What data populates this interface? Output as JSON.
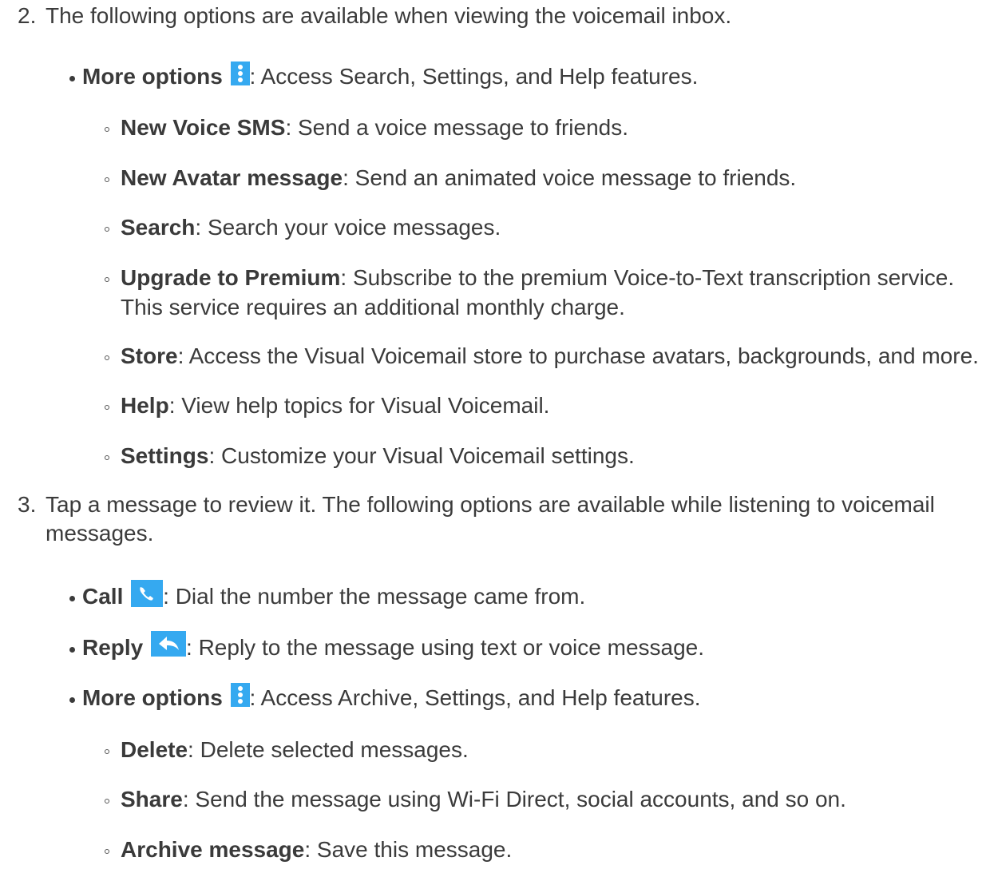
{
  "step2": {
    "number": "2.",
    "text": "The following options are available when viewing the voicemail inbox.",
    "more_options": {
      "label": "More options",
      "icon": "more-vert-icon",
      "desc": ": Access Search, Settings, and Help features."
    },
    "sub_items": [
      {
        "label": "New Voice SMS",
        "desc": ": Send a voice message to friends."
      },
      {
        "label": "New Avatar message",
        "desc": ": Send an animated voice message to friends."
      },
      {
        "label": "Search",
        "desc": ": Search your voice messages."
      },
      {
        "label": "Upgrade to Premium",
        "desc": ": Subscribe to the premium Voice-to-Text transcription service.",
        "desc2": "This service requires an additional monthly charge."
      },
      {
        "label": "Store",
        "desc": ": Access the Visual Voicemail store to purchase avatars, backgrounds, and more."
      },
      {
        "label": "Help",
        "desc": ": View help topics for Visual Voicemail."
      },
      {
        "label": "Settings",
        "desc": ": Customize your Visual Voicemail settings."
      }
    ]
  },
  "step3": {
    "number": "3.",
    "text_line1": "Tap a message to review it. The following options are available while listening to voicemail",
    "text_line2": "messages.",
    "items": [
      {
        "label": "Call",
        "icon": "phone-icon",
        "desc": ": Dial the number the message came from."
      },
      {
        "label": "Reply",
        "icon": "reply-icon",
        "desc": ": Reply to the message using text or voice message."
      },
      {
        "label": "More options",
        "icon": "more-vert-icon",
        "desc": ": Access Archive, Settings, and Help features."
      }
    ],
    "sub_items": [
      {
        "label": "Delete",
        "desc": ": Delete selected messages."
      },
      {
        "label": "Share",
        "desc": ": Send the message using Wi-Fi Direct, social accounts, and so on."
      },
      {
        "label": "Archive message",
        "desc": ": Save this message."
      }
    ]
  },
  "colors": {
    "text": "#3b3b3b",
    "icon_blue": "#35a9f0"
  }
}
